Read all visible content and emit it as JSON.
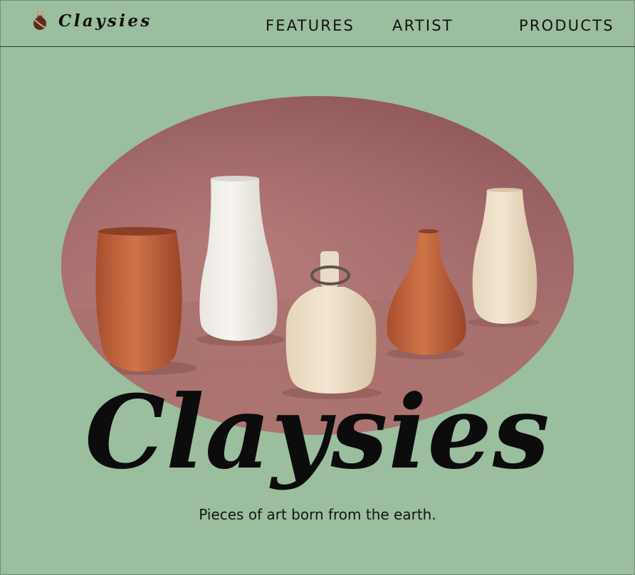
{
  "brand": {
    "name": "Claysies",
    "logo_icon": "vase-logo-icon"
  },
  "nav": {
    "items": [
      {
        "label": "FEATURES"
      },
      {
        "label": "ARTIST"
      },
      {
        "label": "PRODUCTS"
      }
    ]
  },
  "hero": {
    "image_icon": "ceramic-vases-photo",
    "title": "Claysies",
    "tagline": "Pieces of art born from the earth."
  },
  "colors": {
    "background": "#9bbe9f",
    "text": "#111111",
    "terracotta": "#c96a3f",
    "cream": "#efe6d6",
    "backdrop": "#9a5f60"
  }
}
